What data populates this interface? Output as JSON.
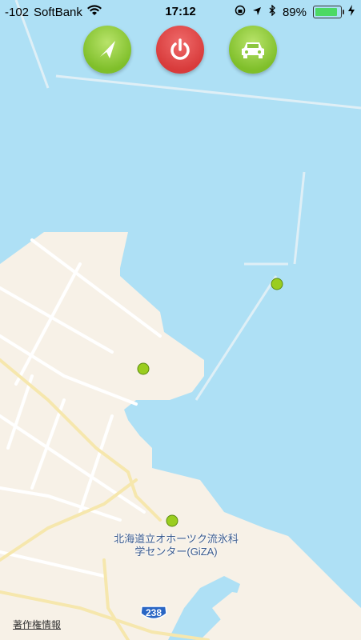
{
  "status_bar": {
    "signal": "-102",
    "carrier": "SoftBank",
    "time": "17:12",
    "battery_percent": "89%",
    "battery_level": 0.89
  },
  "toolbar": {
    "location_icon": "location-arrow-icon",
    "power_icon": "power-icon",
    "car_icon": "car-icon",
    "accent_green": "#8cc63f",
    "accent_red": "#de4545"
  },
  "map": {
    "poi_label_line1": "北海道立オホーツク流氷科",
    "poi_label_line2": "学センター(GiZA)",
    "route_number": "238",
    "legal_link": "著作権情報",
    "water_color": "#aee0f5",
    "land_color": "#f7f1e7",
    "road_color": "#f6e7ad"
  }
}
